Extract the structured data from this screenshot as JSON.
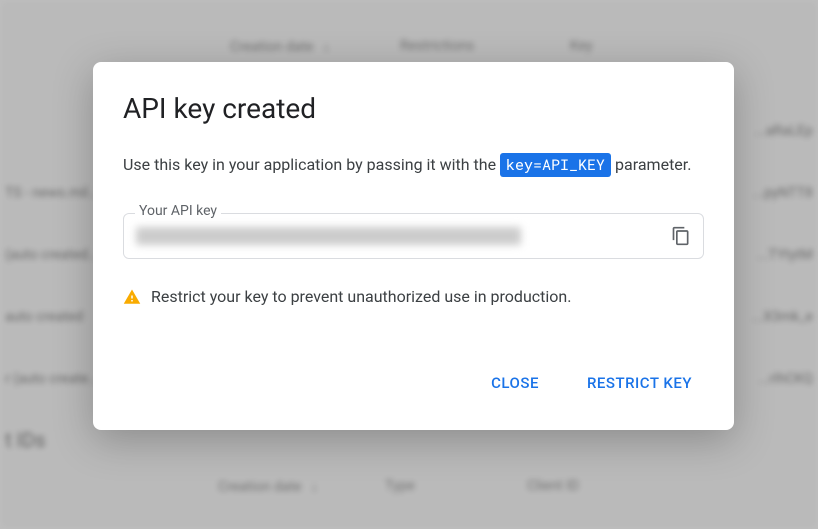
{
  "background": {
    "columns": {
      "creation_date": "Creation date",
      "restrictions": "Restrictions",
      "key": "Key"
    },
    "rows": [
      {
        "left": "",
        "right": "...aRaLEp"
      },
      {
        "left": "TS - news.mil...",
        "right": "...pyNTT8"
      },
      {
        "left": "(auto created...",
        "right": "...TYtytM"
      },
      {
        "left": "auto created",
        "right": "...X3mk_e"
      },
      {
        "left": "r (auto create...",
        "right": "...rIhCKQ"
      }
    ],
    "section_title": "t IDs",
    "columns2": {
      "creation_date": "Creation date",
      "type": "Type",
      "client_id": "Client ID"
    }
  },
  "dialog": {
    "title": "API key created",
    "description_prefix": "Use this key in your application by passing it with the ",
    "code_param": "key=API_KEY",
    "description_suffix": " parameter.",
    "field_label": "Your API key",
    "warning_text": "Restrict your key to prevent unauthorized use in production.",
    "actions": {
      "close": "CLOSE",
      "restrict": "RESTRICT KEY"
    }
  }
}
